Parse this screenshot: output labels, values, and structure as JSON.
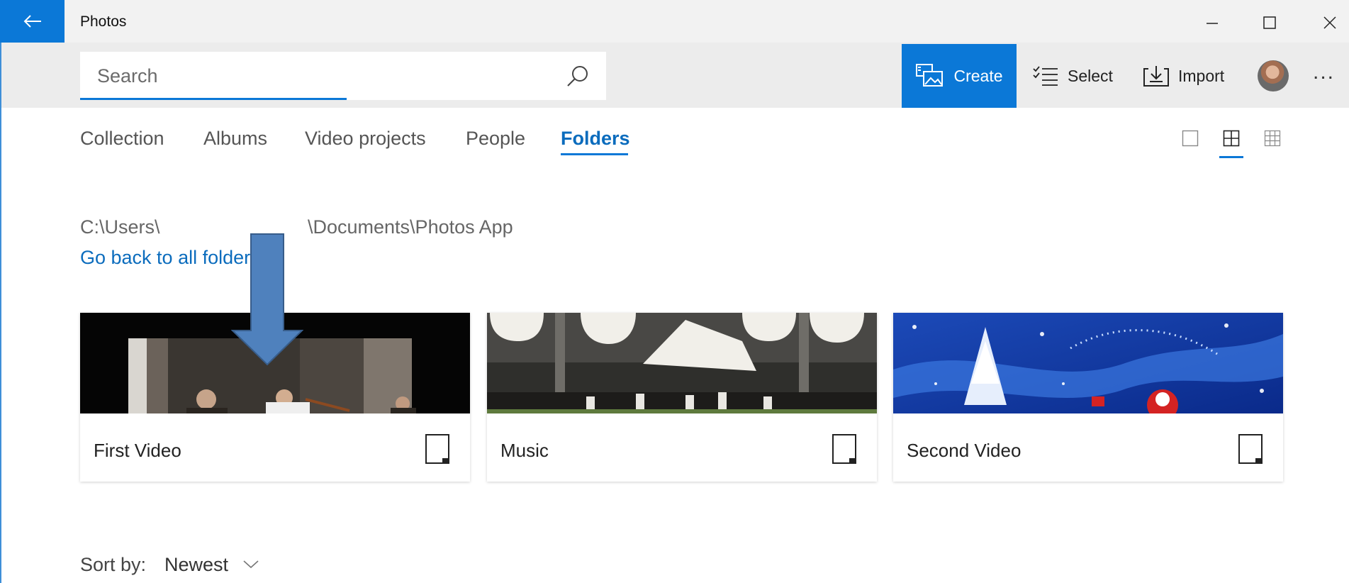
{
  "window": {
    "title": "Photos",
    "controls": [
      "minimize",
      "maximize",
      "close"
    ]
  },
  "toolbar": {
    "search_placeholder": "Search",
    "create_label": "Create",
    "select_label": "Select",
    "import_label": "Import",
    "more_label": "..."
  },
  "tabs": [
    {
      "label": "Collection",
      "active": false
    },
    {
      "label": "Albums",
      "active": false
    },
    {
      "label": "Video projects",
      "active": false
    },
    {
      "label": "People",
      "active": false
    },
    {
      "label": "Folders",
      "active": true
    }
  ],
  "view_modes": [
    {
      "name": "large",
      "active": false
    },
    {
      "name": "medium",
      "active": true
    },
    {
      "name": "small",
      "active": false
    }
  ],
  "path": {
    "start": "C:\\Users\\",
    "end": "\\Documents\\Photos App",
    "go_back_link": "Go back to all folders"
  },
  "folders": [
    {
      "name": "First Video",
      "thumbnail": "quartet-in-venue"
    },
    {
      "name": "Music",
      "thumbnail": "cafe-umbrellas"
    },
    {
      "name": "Second Video",
      "thumbnail": "christmas-tree-blue"
    }
  ],
  "sort": {
    "label": "Sort by:",
    "value": "Newest"
  },
  "colors": {
    "accent": "#0b78d7",
    "link": "#0b6cbd",
    "annotation_arrow": "#4f81bd"
  },
  "icons": {
    "back": "back-arrow-icon",
    "search": "search-icon",
    "create": "create-icon",
    "select": "select-icon",
    "import": "import-icon",
    "folder": "folder-icon",
    "chevron": "chevron-down-icon"
  }
}
